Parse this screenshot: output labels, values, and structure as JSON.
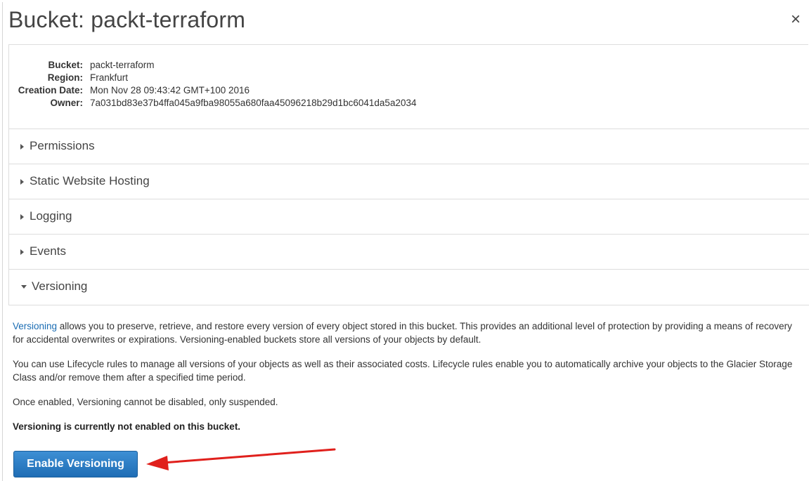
{
  "dialog": {
    "title": "Bucket: packt-terraform",
    "close_label": "×"
  },
  "properties": [
    {
      "label": "Bucket:",
      "value": "packt-terraform"
    },
    {
      "label": "Region:",
      "value": "Frankfurt"
    },
    {
      "label": "Creation Date:",
      "value": "Mon Nov 28 09:43:42 GMT+100 2016"
    },
    {
      "label": "Owner:",
      "value": "7a031bd83e37b4ffa045a9fba98055a680faa45096218b29d1bc6041da5a2034"
    }
  ],
  "sections": [
    {
      "label": "Permissions",
      "expanded": false
    },
    {
      "label": "Static Website Hosting",
      "expanded": false
    },
    {
      "label": "Logging",
      "expanded": false
    },
    {
      "label": "Events",
      "expanded": false
    },
    {
      "label": "Versioning",
      "expanded": true
    }
  ],
  "versioning": {
    "link_text": "Versioning",
    "para1_rest": " allows you to preserve, retrieve, and restore every version of every object stored in this bucket. This provides an additional level of protection by providing a means of recovery for accidental overwrites or expirations. Versioning-enabled buckets store all versions of your objects by default.",
    "para2": "You can use Lifecycle rules to manage all versions of your objects as well as their associated costs. Lifecycle rules enable you to automatically archive your objects to the Glacier Storage Class and/or remove them after a specified time period.",
    "para3": "Once enabled, Versioning cannot be disabled, only suspended.",
    "status": "Versioning is currently not enabled on this bucket.",
    "button_label": "Enable Versioning"
  },
  "colors": {
    "link": "#1a6cb3",
    "button": "#2b7bc4",
    "annotation_arrow": "#e0201c"
  }
}
